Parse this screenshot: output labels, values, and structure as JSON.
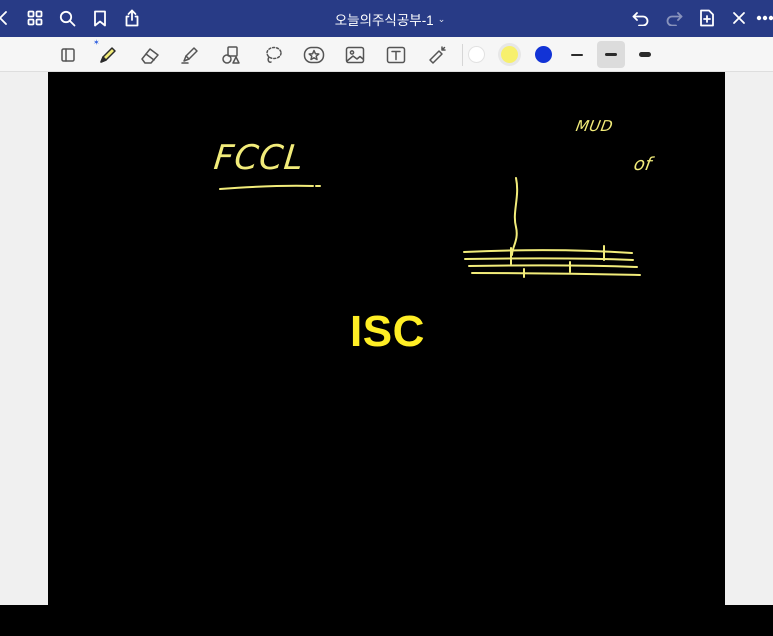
{
  "topbar": {
    "title": "오늘의주식공부-1",
    "icons": [
      "back-chevron-icon",
      "grid-icon",
      "search-icon",
      "bookmark-icon",
      "share-icon",
      "undo-icon",
      "redo-icon",
      "add-page-icon",
      "close-icon",
      "more-icon"
    ]
  },
  "toolbar": {
    "tools": [
      "page-view-icon",
      "pen-icon",
      "eraser-icon",
      "highlighter-icon",
      "shapes-icon",
      "lasso-icon",
      "sticker-icon",
      "image-icon",
      "text-icon",
      "laser-pointer-icon"
    ],
    "selected_tool": "pen",
    "colors": [
      "#ffffff",
      "#f7f06d",
      "#1233d6"
    ],
    "selected_color": "#f7f06d",
    "stroke_widths": [
      "thin",
      "medium",
      "thick"
    ],
    "selected_stroke": "medium"
  },
  "canvas": {
    "background": "#000000",
    "ink_color": "#f2ec7a",
    "handwritten_1": "FCCL",
    "handwritten_2": "MUD",
    "handwritten_3": "of",
    "big_label": "ISC",
    "big_label_color": "#ffee25"
  }
}
